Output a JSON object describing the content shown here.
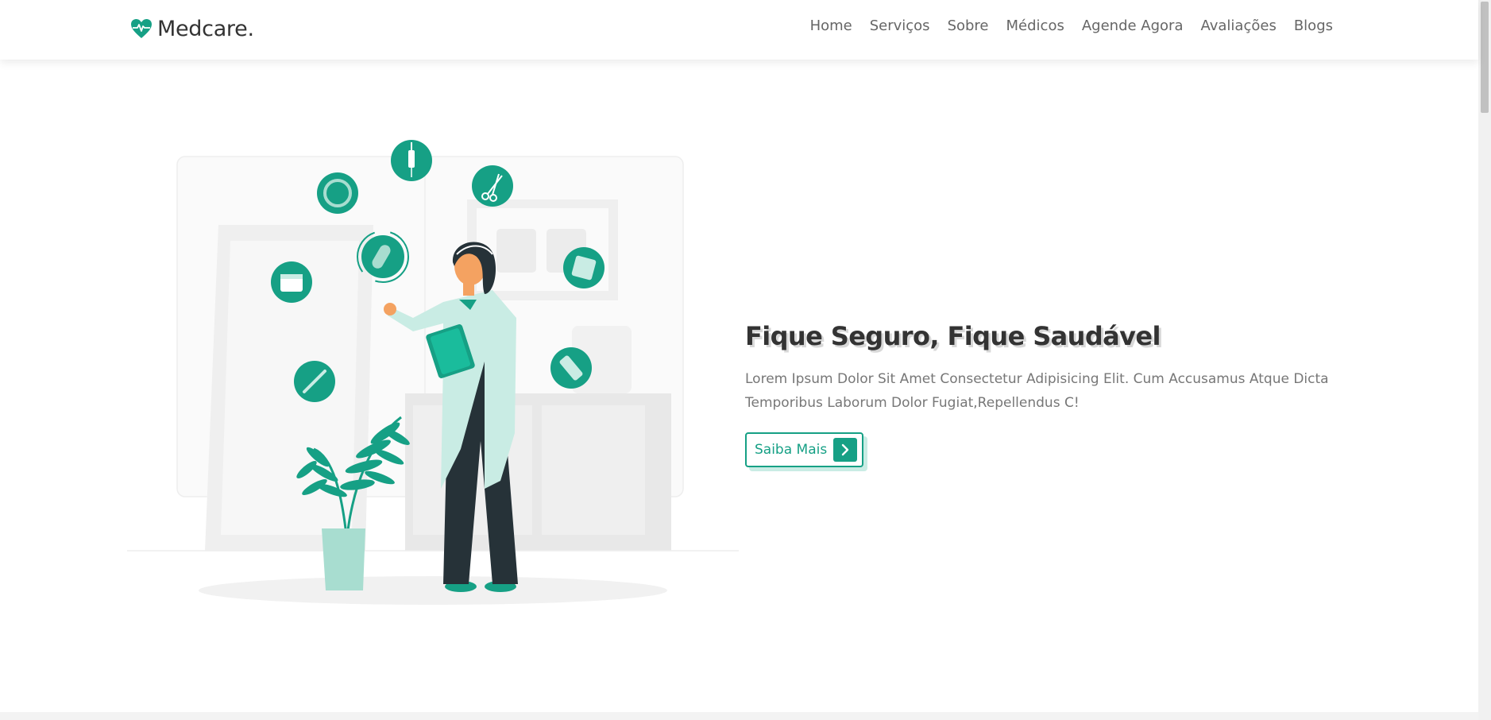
{
  "header": {
    "logo_text": "Medcare.",
    "nav": [
      {
        "label": "Home"
      },
      {
        "label": "Serviços"
      },
      {
        "label": "Sobre"
      },
      {
        "label": "Médicos"
      },
      {
        "label": "Agende Agora"
      },
      {
        "label": "Avaliações"
      },
      {
        "label": "Blogs"
      }
    ]
  },
  "hero": {
    "title": "Fique Seguro, Fique Saudável",
    "text": "Lorem Ipsum Dolor Sit Amet Consectetur Adipisicing Elit. Cum Accusamus Atque Dicta Temporibus Laborum Dolor Fugiat,Repellendus C!",
    "button_label": "Saiba Mais",
    "illustration_icon": "doctor-with-medical-icons-illustration"
  },
  "colors": {
    "accent": "#16a085",
    "accent_light": "#a8ddd0",
    "text_dark": "#333333",
    "text_muted": "#777777"
  }
}
